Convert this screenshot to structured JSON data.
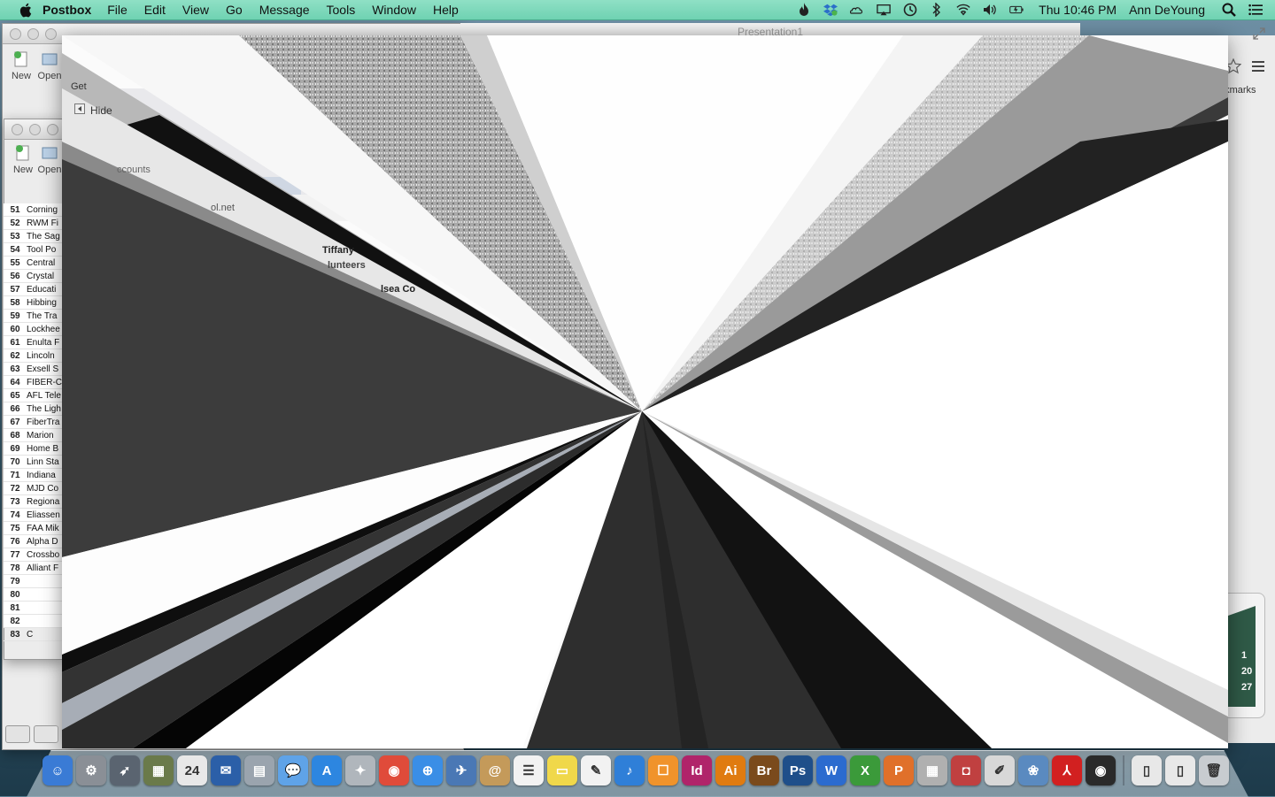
{
  "menubar": {
    "app_name": "Postbox",
    "menus": [
      "File",
      "Edit",
      "View",
      "Go",
      "Message",
      "Tools",
      "Window",
      "Help"
    ],
    "clock": "Thu 10:46 PM",
    "user": "Ann DeYoung"
  },
  "presentation_window": {
    "title": "Presentation1"
  },
  "back_window": {
    "toolbar_new": "New",
    "toolbar_open": "Open",
    "get": "Get",
    "hide": "Hide"
  },
  "back_window2": {
    "toolbar_new": "New",
    "toolbar_open": "Open"
  },
  "sheet_rows": [
    {
      "num": "51",
      "name": "Corning"
    },
    {
      "num": "52",
      "name": "RWM Fi"
    },
    {
      "num": "53",
      "name": "The Sag"
    },
    {
      "num": "54",
      "name": "Tool Po"
    },
    {
      "num": "55",
      "name": "Central"
    },
    {
      "num": "56",
      "name": "Crystal"
    },
    {
      "num": "57",
      "name": "Educati"
    },
    {
      "num": "58",
      "name": "Hibbing"
    },
    {
      "num": "59",
      "name": "The Tra"
    },
    {
      "num": "60",
      "name": "Lockhee"
    },
    {
      "num": "61",
      "name": "Enulta F"
    },
    {
      "num": "62",
      "name": "Lincoln"
    },
    {
      "num": "63",
      "name": "Exsell S"
    },
    {
      "num": "64",
      "name": "FIBER-C"
    },
    {
      "num": "65",
      "name": "AFL Tele"
    },
    {
      "num": "66",
      "name": "The Ligh"
    },
    {
      "num": "67",
      "name": "FiberTra"
    },
    {
      "num": "68",
      "name": "Marion"
    },
    {
      "num": "69",
      "name": "Home B"
    },
    {
      "num": "70",
      "name": "Linn Sta"
    },
    {
      "num": "71",
      "name": "Indiana"
    },
    {
      "num": "72",
      "name": "MJD Co"
    },
    {
      "num": "73",
      "name": "Regiona"
    },
    {
      "num": "74",
      "name": "Eliassen"
    },
    {
      "num": "75",
      "name": "FAA Mik"
    },
    {
      "num": "76",
      "name": "Alpha D"
    },
    {
      "num": "77",
      "name": "Crossbo"
    },
    {
      "num": "78",
      "name": "Alliant F"
    },
    {
      "num": "79",
      "name": ""
    },
    {
      "num": "80",
      "name": ""
    },
    {
      "num": "81",
      "name": ""
    },
    {
      "num": "82",
      "name": ""
    },
    {
      "num": "83",
      "name": "C"
    }
  ],
  "right_window": {
    "bookmarks": "okmarks"
  },
  "calendar_numbers": [
    "1",
    "20",
    "27"
  ],
  "glitch_fragments": {
    "tiffany": "Tiffany",
    "volunteers": "lunteers",
    "chelsea": "lsea Co",
    "accounts": "ccounts",
    "email": "ol.net"
  },
  "dock": {
    "items": [
      {
        "name": "finder",
        "color": "#3a7bd5",
        "glyph": "☺"
      },
      {
        "name": "system-preferences",
        "color": "#8a8f96",
        "glyph": "⚙"
      },
      {
        "name": "launchpad",
        "color": "#5a6470",
        "glyph": "➶"
      },
      {
        "name": "photo-browser",
        "color": "#6a7a4a",
        "glyph": "▦"
      },
      {
        "name": "calendar",
        "color": "#e8e8e8",
        "glyph": "24"
      },
      {
        "name": "thunderbird",
        "color": "#2b5fa8",
        "glyph": "✉"
      },
      {
        "name": "preview",
        "color": "#9aa4ae",
        "glyph": "▤"
      },
      {
        "name": "messages",
        "color": "#5fa3e8",
        "glyph": "💬"
      },
      {
        "name": "app-store",
        "color": "#2d86e0",
        "glyph": "A"
      },
      {
        "name": "compass",
        "color": "#b0b6bc",
        "glyph": "✦"
      },
      {
        "name": "chrome",
        "color": "#e04b3a",
        "glyph": "◉"
      },
      {
        "name": "safari",
        "color": "#3a8ee6",
        "glyph": "⊕"
      },
      {
        "name": "postbox",
        "color": "#4a78b5",
        "glyph": "✈"
      },
      {
        "name": "address-book",
        "color": "#c49a5a",
        "glyph": "@"
      },
      {
        "name": "reminders",
        "color": "#f2f2f2",
        "glyph": "☰"
      },
      {
        "name": "stickies",
        "color": "#f0d84a",
        "glyph": "▭"
      },
      {
        "name": "textedit",
        "color": "#f2f2f2",
        "glyph": "✎"
      },
      {
        "name": "itunes",
        "color": "#2f7fd8",
        "glyph": "♪"
      },
      {
        "name": "ibooks",
        "color": "#f0932b",
        "glyph": "☐"
      },
      {
        "name": "indesign",
        "color": "#b0246a",
        "glyph": "Id"
      },
      {
        "name": "illustrator",
        "color": "#e07b10",
        "glyph": "Ai"
      },
      {
        "name": "bridge",
        "color": "#7a4a1c",
        "glyph": "Br"
      },
      {
        "name": "photoshop",
        "color": "#1f4f8a",
        "glyph": "Ps"
      },
      {
        "name": "word",
        "color": "#2b6bcf",
        "glyph": "W"
      },
      {
        "name": "excel",
        "color": "#3b9a3a",
        "glyph": "X"
      },
      {
        "name": "powerpoint",
        "color": "#e0702a",
        "glyph": "P"
      },
      {
        "name": "calculator",
        "color": "#b0b0b0",
        "glyph": "▦"
      },
      {
        "name": "photo-booth",
        "color": "#c04040",
        "glyph": "◘"
      },
      {
        "name": "script-editor",
        "color": "#d8d8d8",
        "glyph": "✐"
      },
      {
        "name": "iphoto",
        "color": "#5a8ac0",
        "glyph": "❀"
      },
      {
        "name": "acrobat",
        "color": "#d22020",
        "glyph": "⅄"
      },
      {
        "name": "screenshot",
        "color": "#2a2a2a",
        "glyph": "◉"
      },
      {
        "name": "pdf-document",
        "color": "#e8e8e8",
        "glyph": "▯"
      },
      {
        "name": "document-stack",
        "color": "#e8e8e8",
        "glyph": "▯"
      },
      {
        "name": "trash",
        "color": "#c8ccd0",
        "glyph": "🗑"
      }
    ]
  }
}
